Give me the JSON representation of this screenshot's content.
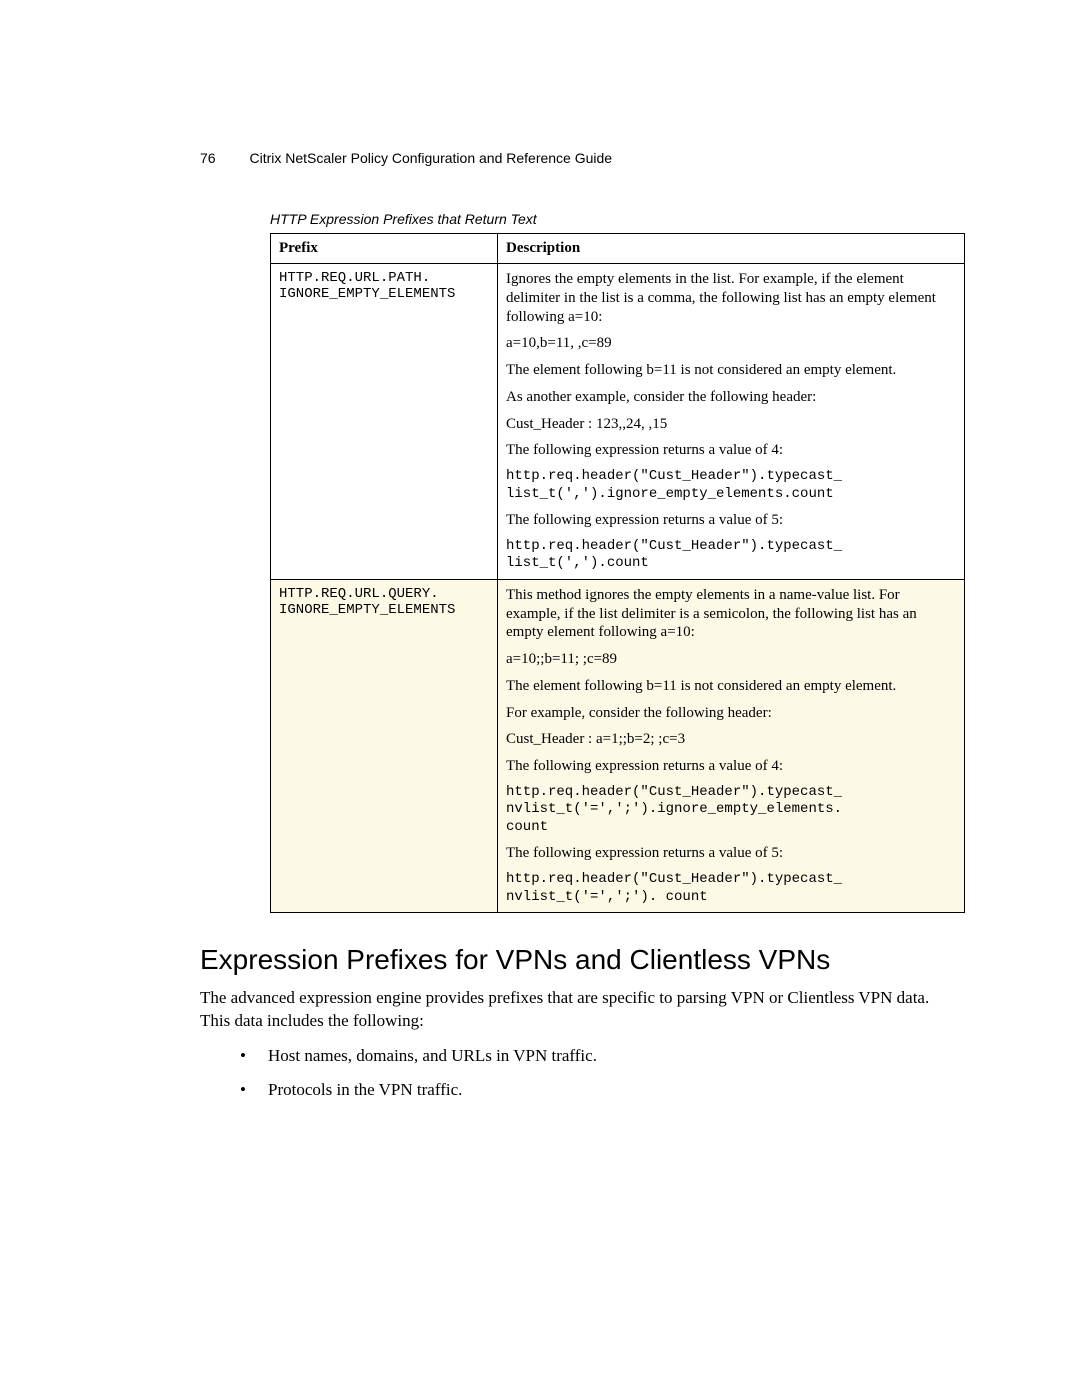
{
  "header": {
    "page_number": "76",
    "doc_title": "Citrix NetScaler Policy Configuration and Reference Guide"
  },
  "table": {
    "caption": "HTTP Expression Prefixes that Return Text",
    "columns": {
      "c1": "Prefix",
      "c2": "Description"
    },
    "rows": [
      {
        "prefix_a": "HTTP.REQ.URL.PATH.",
        "prefix_b": "IGNORE_EMPTY_ELEMENTS",
        "d1": "Ignores the empty elements in the list. For example, if the element delimiter in the list is a comma, the following list has an empty element following a=10:",
        "d2": "a=10,b=11, ,c=89",
        "d3": "The element following b=11 is not considered an empty element.",
        "d4": "As another example, consider the following header:",
        "d5": "Cust_Header : 123,,24, ,15",
        "d6": "The following expression returns a value of 4:",
        "d7a": "http.req.header(\"Cust_Header\").typecast_",
        "d7b": "list_t(',').ignore_empty_elements.count",
        "d8": "The following expression returns a value of 5:",
        "d9a": "http.req.header(\"Cust_Header\").typecast_",
        "d9b": "list_t(',').count"
      },
      {
        "prefix_a": "HTTP.REQ.URL.QUERY.",
        "prefix_b": "IGNORE_EMPTY_ELEMENTS",
        "d1": "This method ignores the empty elements in a name-value list. For example, if the list delimiter is a semicolon, the following list has an empty element following a=10:",
        "d2": "a=10;;b=11; ;c=89",
        "d3": "The element following b=11 is not considered an empty element.",
        "d4": "For example, consider the following header:",
        "d5": "Cust_Header : a=1;;b=2; ;c=3",
        "d6": "The following expression returns a value of 4:",
        "d7a": "http.req.header(\"Cust_Header\").typecast_",
        "d7b": "nvlist_t('=',';').ignore_empty_elements.",
        "d7c": "count",
        "d8": "The following expression returns a value of 5:",
        "d9a": "http.req.header(\"Cust_Header\").typecast_",
        "d9b": "nvlist_t('=',';'). count"
      }
    ]
  },
  "section": {
    "heading": "Expression Prefixes for VPNs and Clientless VPNs",
    "intro": "The advanced expression engine provides prefixes that are specific to parsing VPN or Clientless VPN data. This data includes the following:",
    "bullets": [
      "Host names, domains, and URLs in VPN traffic.",
      "Protocols in the VPN traffic."
    ]
  }
}
